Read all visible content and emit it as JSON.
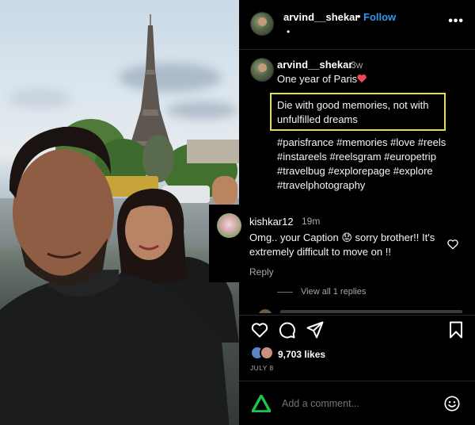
{
  "header": {
    "username": "arvind__shekar",
    "separator": "•",
    "follow_label": "Follow",
    "second_dot": "•",
    "more_icon": "more-horizontal-icon",
    "more_label": "•••"
  },
  "caption": {
    "username": "arvind__shekar",
    "time": "3w",
    "line1": "One year of Paris",
    "quote": "Die with good memories, not with unfulfilled dreams",
    "hashtags": [
      "#parisfrance",
      "#memories",
      "#love",
      "#reels",
      "#instareels",
      "#reelsgram",
      "#europetrip",
      "#travelbug",
      "#explorepage",
      "#explore",
      "#travelphotography"
    ]
  },
  "comment": {
    "username": "kishkar12",
    "time": "19m",
    "text": "Omg.. your Caption 😟 sorry brother!! It's extremely difficult to move on !!",
    "reply_label": "Reply"
  },
  "view_replies": "View all 1 replies",
  "actions": {
    "icons": [
      "heart-icon",
      "comment-icon",
      "share-icon",
      "bookmark-icon"
    ]
  },
  "likes": "9,703 likes",
  "date": "JULY 8",
  "add_comment": {
    "placeholder": "Add a comment..."
  },
  "colors": {
    "background": "#000000",
    "accent": "#3797f0",
    "highlight_box": "#e8e03a",
    "heart_red": "#ed4956",
    "logo_green": "#21c24b"
  }
}
